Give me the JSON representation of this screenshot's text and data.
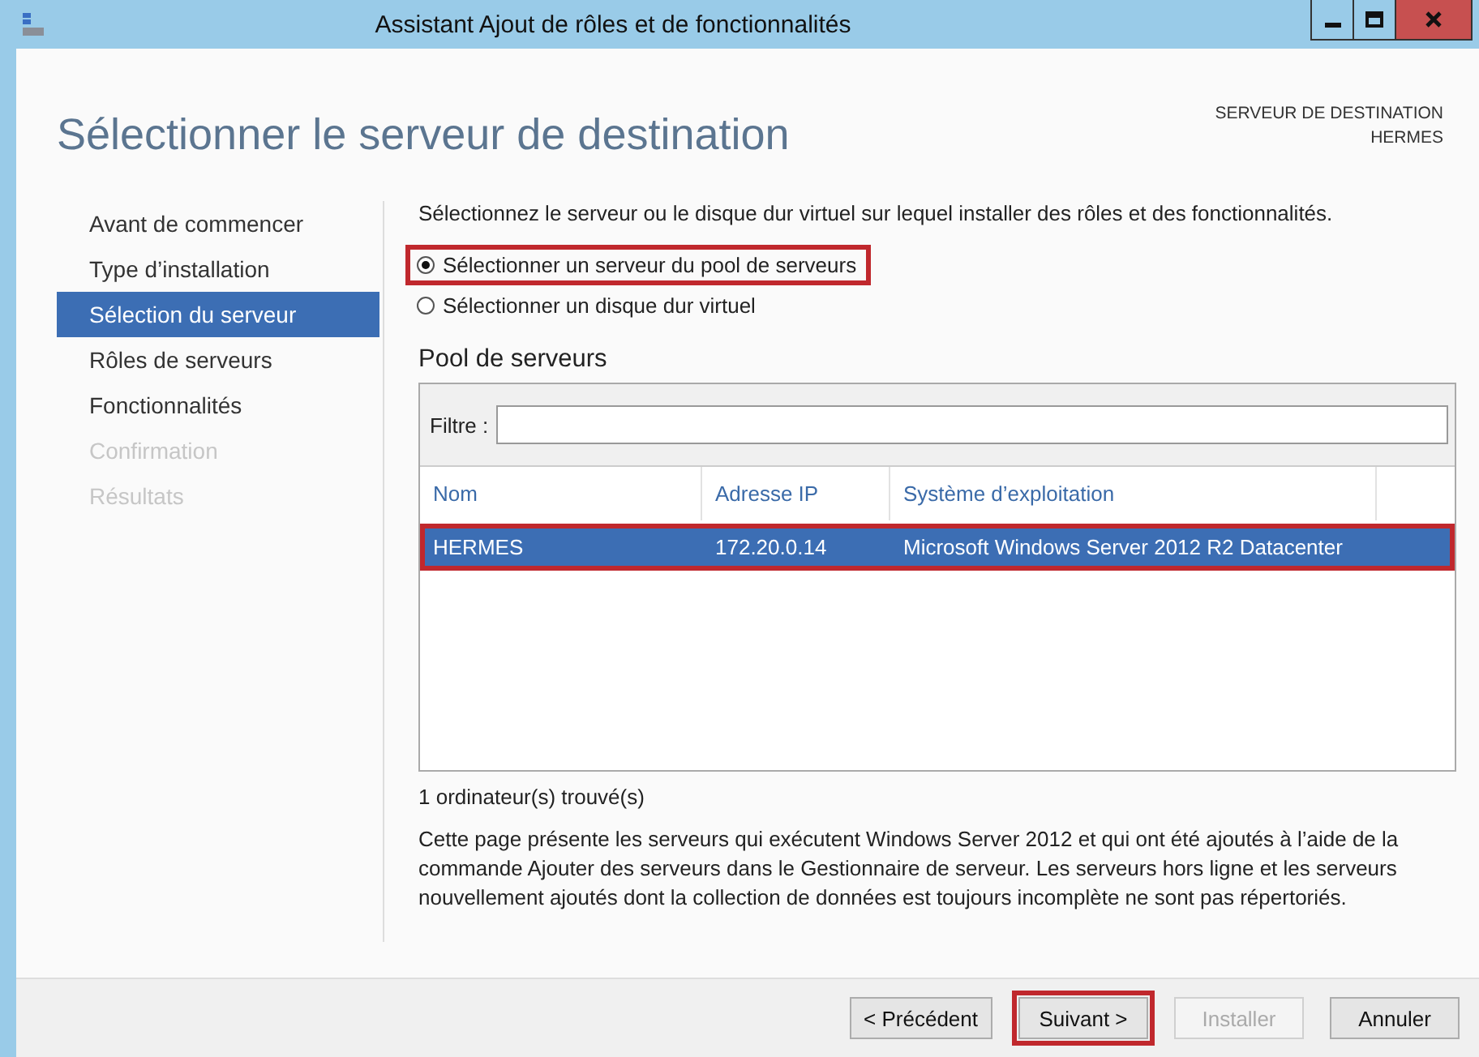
{
  "window": {
    "title": "Assistant Ajout de rôles et de fonctionnalités"
  },
  "header": {
    "title": "Sélectionner le serveur de destination",
    "target_label": "SERVEUR DE DESTINATION",
    "target_value": "HERMES"
  },
  "sidebar": {
    "items": [
      {
        "label": "Avant de commencer",
        "selected": false,
        "disabled": false
      },
      {
        "label": "Type d’installation",
        "selected": false,
        "disabled": false
      },
      {
        "label": "Sélection du serveur",
        "selected": true,
        "disabled": false
      },
      {
        "label": "Rôles de serveurs",
        "selected": false,
        "disabled": false
      },
      {
        "label": "Fonctionnalités",
        "selected": false,
        "disabled": false
      },
      {
        "label": "Confirmation",
        "selected": false,
        "disabled": true
      },
      {
        "label": "Résultats",
        "selected": false,
        "disabled": true
      }
    ]
  },
  "intro": "Sélectionnez le serveur ou le disque dur virtuel sur lequel installer des rôles et des fonctionnalités.",
  "options": [
    {
      "label": "Sélectionner un serveur du pool de serveurs",
      "selected": true,
      "highlighted": true
    },
    {
      "label": "Sélectionner un disque dur virtuel",
      "selected": false,
      "highlighted": false
    }
  ],
  "pool": {
    "title": "Pool de serveurs",
    "filter_label": "Filtre :",
    "columns": [
      "Nom",
      "Adresse IP",
      "Système d’exploitation"
    ],
    "rows": [
      {
        "cells": [
          "HERMES",
          "172.20.0.14",
          "Microsoft Windows Server 2012 R2 Datacenter"
        ],
        "selected": true,
        "highlighted": true
      }
    ],
    "count": "1 ordinateur(s) trouvé(s)"
  },
  "note": "Cette page présente les serveurs qui exécutent Windows Server 2012 et qui ont été ajoutés à l’aide de la commande Ajouter des serveurs dans le Gestionnaire de serveur. Les serveurs hors ligne et les serveurs nouvellement ajoutés dont la collection de données est toujours incomplète ne sont pas répertoriés.",
  "buttons": [
    {
      "label": "< Précédent",
      "disabled": false,
      "highlighted": false
    },
    {
      "label": "Suivant >",
      "disabled": false,
      "highlighted": true
    },
    {
      "label": "Installer",
      "disabled": true,
      "highlighted": false
    },
    {
      "label": "Annuler",
      "disabled": false,
      "highlighted": false
    }
  ]
}
